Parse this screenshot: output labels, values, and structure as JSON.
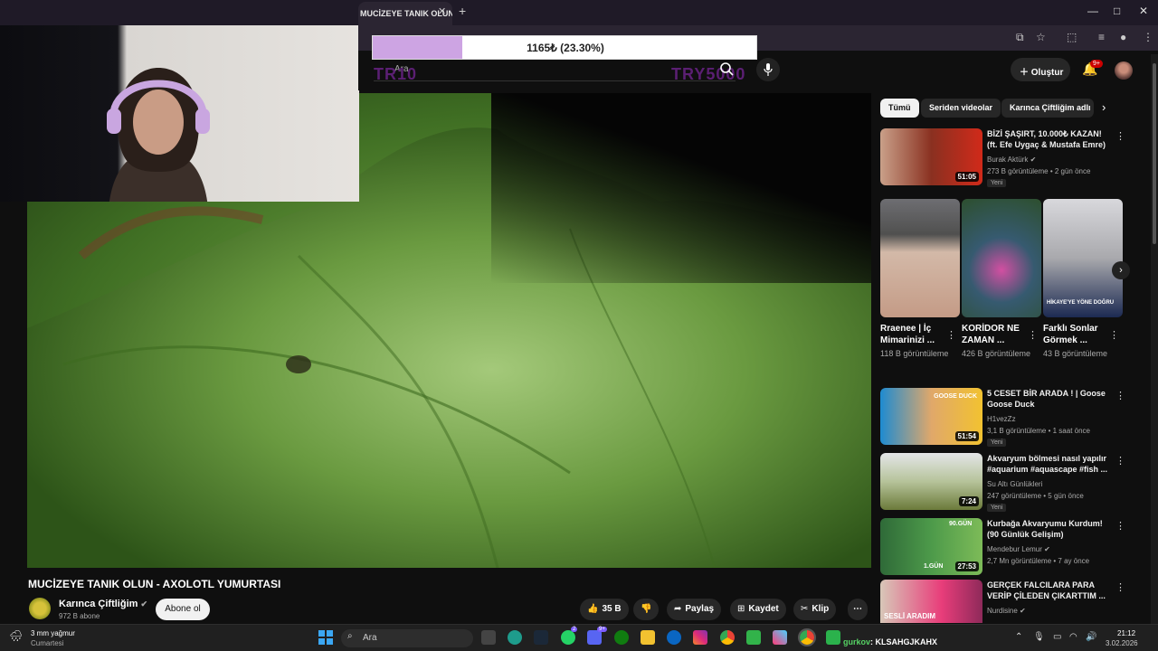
{
  "browser": {
    "tab_title": "MUCİZEYE TANIK OLUN",
    "tab_close": "✕",
    "new_tab": "+"
  },
  "goal": {
    "text": "1165₺ (23.30%)",
    "progress_percent": 23.3,
    "fill_color": "#cda4e3"
  },
  "header": {
    "search_placeholder": "Ara",
    "overlay_left": "TR10",
    "overlay_right": "TRY5000",
    "create_label": "Oluştur",
    "notif_badge": "9+"
  },
  "video": {
    "title": "MUCİZEYE TANIK OLUN - AXOLOTL YUMURTASI",
    "channel": "Karınca Çiftliğim",
    "subscribers": "972 B abone",
    "subscribe_label": "Abone ol",
    "likes": "35 B",
    "share_label": "Paylaş",
    "save_label": "Kaydet",
    "clip_label": "Klip",
    "more": "⋯"
  },
  "sidebar": {
    "chips": [
      "Tümü",
      "Seriden videolar",
      "Karınca Çiftliğim adlı"
    ],
    "recs": [
      {
        "title": "BİZİ ŞAŞIRT, 10.000₺ KAZAN! (ft. Efe Uygaç & Mustafa Emre)",
        "channel": "Burak Aktürk ✔",
        "meta": "273 B görüntüleme • 2 gün önce",
        "badge": "Yeni",
        "duration": "51:05"
      },
      {
        "title": "5 CESET BİR ARADA ! | Goose Goose Duck",
        "channel": "H1vezZz",
        "meta": "3,1 B görüntüleme • 1 saat önce",
        "badge": "Yeni",
        "duration": "51:54"
      },
      {
        "title": "Akvaryum bölmesi nasıl yapılır #aquarium #aquascape #fish ...",
        "channel": "Su Altı Günlükleri",
        "meta": "247 görüntüleme • 5 gün önce",
        "badge": "Yeni",
        "duration": "7:24"
      },
      {
        "title": "Kurbağa Akvaryumu Kurdum! (90 Günlük Gelişim)",
        "channel": "Mendebur Lemur ✔",
        "meta": "2,7 Mn görüntüleme • 7 ay önce",
        "badge": "",
        "duration": "27:53"
      },
      {
        "title": "GERÇEK FALCILARA PARA VERİP ÇİLEDEN ÇIKARTTIM ...",
        "channel": "Nurdisine ✔",
        "meta": "",
        "badge": "",
        "duration": ""
      }
    ],
    "shorts": [
      {
        "title": "Rraenee | İç Mimarinizi ...",
        "views": "118 B görüntüleme"
      },
      {
        "title": "KORİDOR NE ZAMAN ...",
        "views": "426 B görüntüleme"
      },
      {
        "title": "Farklı Sonlar Görmek ...",
        "views": "43 B görüntüleme"
      }
    ],
    "thumb_text": {
      "goose_duck": "GOOSE DUCK",
      "day90": "90.GÜN",
      "day1": "1.GÜN",
      "sesli": "SESLİ ARADIM",
      "hikaye": "HİKAYE'YE YÖNE DOĞRU"
    }
  },
  "taskbar": {
    "weather_title": "3 mm yağmur",
    "weather_sub": "Cumartesi",
    "search_placeholder": "Ara",
    "chat_user": "gurkov",
    "chat_text": ": KLSAHGJKAHX",
    "time": "21:12",
    "date": "3.02.2026"
  }
}
